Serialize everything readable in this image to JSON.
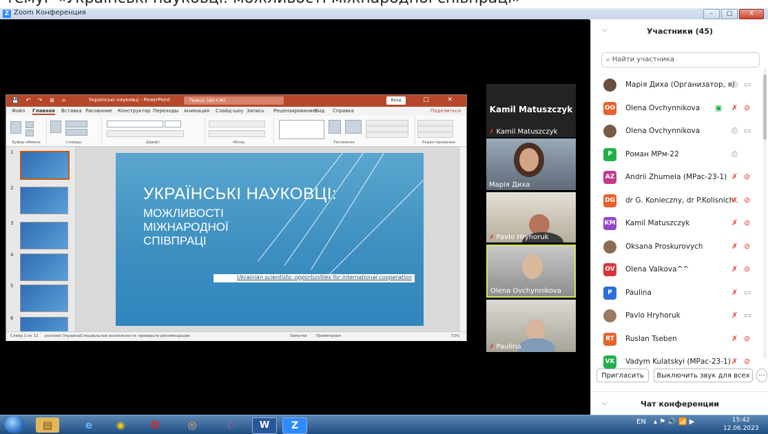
{
  "top_caption": "темуг «Українські науковці: можливості міжнародної співпраці»",
  "window": {
    "title": "Zoom Конференция",
    "logo": "Z",
    "min": "–",
    "max": "□",
    "close": "X"
  },
  "ppt": {
    "filename": "Українські науковці - PowerPoint",
    "search_placeholder": "Поиск (Alt+Ж)",
    "qat": "💾 ↶ ↷ ⊞ =",
    "account": "Вход",
    "window_ctrl": "─ □ ✕",
    "menu": [
      "Файл",
      "Главная",
      "Вставка",
      "Рисование",
      "Конструктор",
      "Переходы",
      "Анимация",
      "Слайд-шоу",
      "Запись",
      "Рецензирование",
      "Вид",
      "Справка"
    ],
    "share": "Поделиться",
    "ribbon_groups": [
      "Буфер обмена",
      "Слайды",
      "Шрифт",
      "Абзац",
      "Рисование",
      "Редактирование"
    ],
    "slide_numbers": [
      "1",
      "2",
      "3",
      "4",
      "5",
      "6"
    ],
    "slide": {
      "title": "УКРАЇНСЬКІ НАУКОВЦІ:",
      "subtitle": "МОЖЛИВОСТІ\nМІЖНАРОДНОЇ\nСПІВПРАЦІ",
      "caption": "Ukrainian scientists: opportunities for international cooperation"
    },
    "status_left": "Слайд 1 из 12",
    "status_lang": "русский (Украина)",
    "status_access": "Специальные возможности: проверьте рекомендации",
    "status_notes": "Заметки",
    "status_comments": "Примечания",
    "status_zoom": "72%"
  },
  "videos": [
    {
      "name": "Kamil Matuszczyk",
      "muted": true,
      "big": "Kamil Matuszczyk"
    },
    {
      "name": "Марія Диха",
      "muted": false
    },
    {
      "name": "Pavlo Hryhoruk",
      "muted": true
    },
    {
      "name": "Olena Ovchynnikova",
      "muted": false
    },
    {
      "name": "Paulina",
      "muted": true
    }
  ],
  "panel": {
    "title": "Участники (45)",
    "search_placeholder": "Найти участника",
    "participants": [
      {
        "name": "Марія Диха (Организатор, я)",
        "initials": "",
        "color": "#6b4e3d",
        "photo": true,
        "mic": "on",
        "cam": "on"
      },
      {
        "name": "Olena Ovchynnikova",
        "initials": "OO",
        "color": "#e8612c",
        "mic": "off",
        "cam": "off",
        "share": true
      },
      {
        "name": "Olena Ovchynnikova",
        "initials": "",
        "color": "#7a5a44",
        "photo": true,
        "mic": "on",
        "cam": "on"
      },
      {
        "name": "Роман МРм-22",
        "initials": "P",
        "color": "#22b04b",
        "mic": "on",
        "cam": ""
      },
      {
        "name": "Andrii Zhumela (МРас-23-1)",
        "initials": "AZ",
        "color": "#c13a8b",
        "mic": "off",
        "cam": "off"
      },
      {
        "name": "dr G. Konieczny, dr P.Kolisnich...",
        "initials": "DG",
        "color": "#e8612c",
        "mic": "off",
        "cam": "off"
      },
      {
        "name": "Kamil Matuszczyk",
        "initials": "KM",
        "color": "#9147c6",
        "mic": "off",
        "cam": "off"
      },
      {
        "name": "Oksana Proskurovych",
        "initials": "",
        "color": "#8a6b55",
        "photo": true,
        "mic": "off",
        "cam": "off"
      },
      {
        "name": "Olena Valkova^^",
        "initials": "OV",
        "color": "#d6363a",
        "mic": "off",
        "cam": "off"
      },
      {
        "name": "Paulina",
        "initials": "P",
        "color": "#2d6fd6",
        "mic": "off",
        "cam": "on"
      },
      {
        "name": "Pavlo Hryhoruk",
        "initials": "",
        "color": "#9a7a62",
        "photo": true,
        "mic": "off",
        "cam": "on"
      },
      {
        "name": "Ruslan Tseben",
        "initials": "RT",
        "color": "#e8612c",
        "mic": "off",
        "cam": "off"
      },
      {
        "name": "Vadym Kulatskyi (МРас-23-1)",
        "initials": "VK",
        "color": "#22b04b",
        "mic": "off",
        "cam": "off"
      }
    ],
    "invite": "Пригласить",
    "mute_all": "Выключить звук для всех",
    "more": "···",
    "chat_title": "Чат конференции"
  },
  "taskbar": {
    "apps": [
      "explorer",
      "ie",
      "chrome",
      "opera",
      "zoom-eye",
      "viber",
      "word",
      "zoom"
    ],
    "lang": "EN",
    "tray": "▴ ⚑ 🔊 📶 ▶",
    "time": "15:42",
    "date": "12.06.2023"
  }
}
